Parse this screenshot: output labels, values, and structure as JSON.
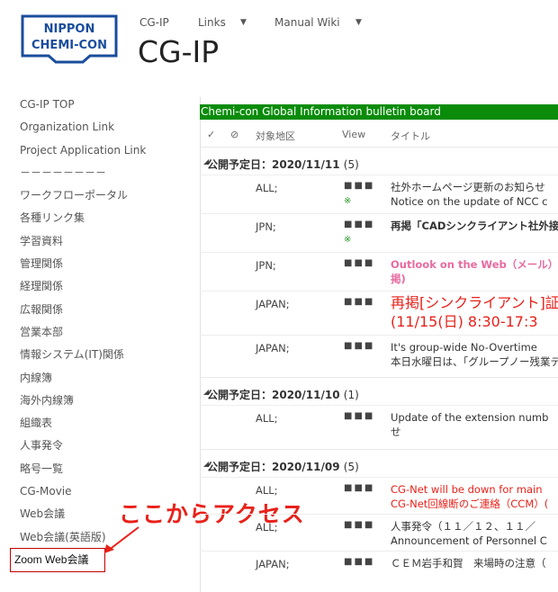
{
  "logo": {
    "line1": "NIPPON",
    "line2": "CHEMI-CON"
  },
  "topnav": {
    "item1": "CG-IP",
    "item2": "Links",
    "item3": "Manual Wiki"
  },
  "site_title": "CG-IP",
  "sidebar": {
    "items": [
      {
        "label": "CG-IP TOP"
      },
      {
        "label": "Organization Link"
      },
      {
        "label": "Project Application Link"
      },
      {
        "label": "－－－－－－－－"
      },
      {
        "label": "ワークフローポータル"
      },
      {
        "label": "各種リンク集"
      },
      {
        "label": "学習資料"
      },
      {
        "label": "管理関係"
      },
      {
        "label": "経理関係"
      },
      {
        "label": "広報関係"
      },
      {
        "label": "営業本部"
      },
      {
        "label": "情報システム(IT)関係"
      },
      {
        "label": "内線簿"
      },
      {
        "label": "海外内線簿"
      },
      {
        "label": "組織表"
      },
      {
        "label": "人事発令"
      },
      {
        "label": "略号一覧"
      },
      {
        "label": "CG-Movie"
      },
      {
        "label": "Web会議"
      },
      {
        "label": "Web会議(英語版)"
      }
    ],
    "zoom": "Zoom Web会議"
  },
  "callout": "ここからアクセス",
  "board": {
    "title": "Chemi-con Global Information bulletin board",
    "col_area": "対象地区",
    "col_view": "View",
    "col_title": "タイトル",
    "groups": [
      {
        "label": "公開予定日：2020/11/11",
        "count": "(5)"
      },
      {
        "label": "公開予定日：2020/11/10",
        "count": "(1)"
      },
      {
        "label": "公開予定日：2020/11/09",
        "count": "(5)"
      }
    ],
    "rows": [
      {
        "area": "ALL;",
        "view": "■■■",
        "new": "※",
        "t1": "社外ホームページ更新のお知らせ",
        "t2": "Notice on the update of NCC c"
      },
      {
        "area": "JPN;",
        "view": "■■■",
        "new": "※",
        "t1": "再掲「CADシンクライアント社外接続"
      },
      {
        "area": "JPN;",
        "view": "■■■",
        "t1": "Outlook on the Web（メール）",
        "t2": "掲)"
      },
      {
        "area": "JAPAN;",
        "view": "■■■",
        "t1": "再掲[シンクライアント]証明",
        "t2": "(11/15(日) 8:30-17:3"
      },
      {
        "area": "JAPAN;",
        "view": "■■■",
        "t1": "It's group-wide No-Overtime",
        "t2": "本日水曜日は、「グループノー残業デ"
      },
      {
        "area": "ALL;",
        "view": "■■■",
        "t1": "Update of the extension numb",
        "t2": "せ"
      },
      {
        "area": "ALL;",
        "view": "■■■",
        "t1": "CG-Net will be down for main",
        "t2": "CG-Net回線断のご連絡（CCM）("
      },
      {
        "area": "ALL;",
        "view": "■■■",
        "t1": "人事発令（１１／１２、１１／",
        "t2": "Announcement of Personnel C"
      },
      {
        "area": "JAPAN;",
        "view": "■■■",
        "t1": "ＣＥＭ岩手和賀　来場時の注意（"
      }
    ]
  },
  "colors": {
    "green_bar": "#0a8c0a",
    "red_text": "#e8211a",
    "pink_text": "#e86aa0",
    "logo_blue": "#1a4d9c"
  }
}
